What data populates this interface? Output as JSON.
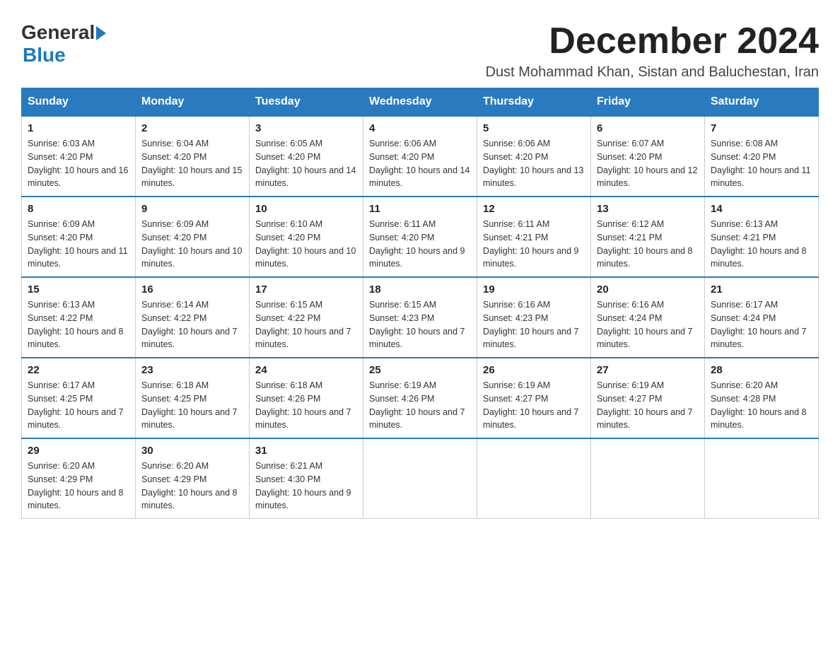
{
  "header": {
    "logo": {
      "general": "General",
      "blue": "Blue",
      "line2": "Blue"
    },
    "title": "December 2024",
    "subtitle": "Dust Mohammad Khan, Sistan and Baluchestan, Iran"
  },
  "weekdays": [
    "Sunday",
    "Monday",
    "Tuesday",
    "Wednesday",
    "Thursday",
    "Friday",
    "Saturday"
  ],
  "weeks": [
    [
      {
        "day": "1",
        "sunrise": "6:03 AM",
        "sunset": "4:20 PM",
        "daylight": "10 hours and 16 minutes."
      },
      {
        "day": "2",
        "sunrise": "6:04 AM",
        "sunset": "4:20 PM",
        "daylight": "10 hours and 15 minutes."
      },
      {
        "day": "3",
        "sunrise": "6:05 AM",
        "sunset": "4:20 PM",
        "daylight": "10 hours and 14 minutes."
      },
      {
        "day": "4",
        "sunrise": "6:06 AM",
        "sunset": "4:20 PM",
        "daylight": "10 hours and 14 minutes."
      },
      {
        "day": "5",
        "sunrise": "6:06 AM",
        "sunset": "4:20 PM",
        "daylight": "10 hours and 13 minutes."
      },
      {
        "day": "6",
        "sunrise": "6:07 AM",
        "sunset": "4:20 PM",
        "daylight": "10 hours and 12 minutes."
      },
      {
        "day": "7",
        "sunrise": "6:08 AM",
        "sunset": "4:20 PM",
        "daylight": "10 hours and 11 minutes."
      }
    ],
    [
      {
        "day": "8",
        "sunrise": "6:09 AM",
        "sunset": "4:20 PM",
        "daylight": "10 hours and 11 minutes."
      },
      {
        "day": "9",
        "sunrise": "6:09 AM",
        "sunset": "4:20 PM",
        "daylight": "10 hours and 10 minutes."
      },
      {
        "day": "10",
        "sunrise": "6:10 AM",
        "sunset": "4:20 PM",
        "daylight": "10 hours and 10 minutes."
      },
      {
        "day": "11",
        "sunrise": "6:11 AM",
        "sunset": "4:20 PM",
        "daylight": "10 hours and 9 minutes."
      },
      {
        "day": "12",
        "sunrise": "6:11 AM",
        "sunset": "4:21 PM",
        "daylight": "10 hours and 9 minutes."
      },
      {
        "day": "13",
        "sunrise": "6:12 AM",
        "sunset": "4:21 PM",
        "daylight": "10 hours and 8 minutes."
      },
      {
        "day": "14",
        "sunrise": "6:13 AM",
        "sunset": "4:21 PM",
        "daylight": "10 hours and 8 minutes."
      }
    ],
    [
      {
        "day": "15",
        "sunrise": "6:13 AM",
        "sunset": "4:22 PM",
        "daylight": "10 hours and 8 minutes."
      },
      {
        "day": "16",
        "sunrise": "6:14 AM",
        "sunset": "4:22 PM",
        "daylight": "10 hours and 7 minutes."
      },
      {
        "day": "17",
        "sunrise": "6:15 AM",
        "sunset": "4:22 PM",
        "daylight": "10 hours and 7 minutes."
      },
      {
        "day": "18",
        "sunrise": "6:15 AM",
        "sunset": "4:23 PM",
        "daylight": "10 hours and 7 minutes."
      },
      {
        "day": "19",
        "sunrise": "6:16 AM",
        "sunset": "4:23 PM",
        "daylight": "10 hours and 7 minutes."
      },
      {
        "day": "20",
        "sunrise": "6:16 AM",
        "sunset": "4:24 PM",
        "daylight": "10 hours and 7 minutes."
      },
      {
        "day": "21",
        "sunrise": "6:17 AM",
        "sunset": "4:24 PM",
        "daylight": "10 hours and 7 minutes."
      }
    ],
    [
      {
        "day": "22",
        "sunrise": "6:17 AM",
        "sunset": "4:25 PM",
        "daylight": "10 hours and 7 minutes."
      },
      {
        "day": "23",
        "sunrise": "6:18 AM",
        "sunset": "4:25 PM",
        "daylight": "10 hours and 7 minutes."
      },
      {
        "day": "24",
        "sunrise": "6:18 AM",
        "sunset": "4:26 PM",
        "daylight": "10 hours and 7 minutes."
      },
      {
        "day": "25",
        "sunrise": "6:19 AM",
        "sunset": "4:26 PM",
        "daylight": "10 hours and 7 minutes."
      },
      {
        "day": "26",
        "sunrise": "6:19 AM",
        "sunset": "4:27 PM",
        "daylight": "10 hours and 7 minutes."
      },
      {
        "day": "27",
        "sunrise": "6:19 AM",
        "sunset": "4:27 PM",
        "daylight": "10 hours and 7 minutes."
      },
      {
        "day": "28",
        "sunrise": "6:20 AM",
        "sunset": "4:28 PM",
        "daylight": "10 hours and 8 minutes."
      }
    ],
    [
      {
        "day": "29",
        "sunrise": "6:20 AM",
        "sunset": "4:29 PM",
        "daylight": "10 hours and 8 minutes."
      },
      {
        "day": "30",
        "sunrise": "6:20 AM",
        "sunset": "4:29 PM",
        "daylight": "10 hours and 8 minutes."
      },
      {
        "day": "31",
        "sunrise": "6:21 AM",
        "sunset": "4:30 PM",
        "daylight": "10 hours and 9 minutes."
      },
      null,
      null,
      null,
      null
    ]
  ]
}
